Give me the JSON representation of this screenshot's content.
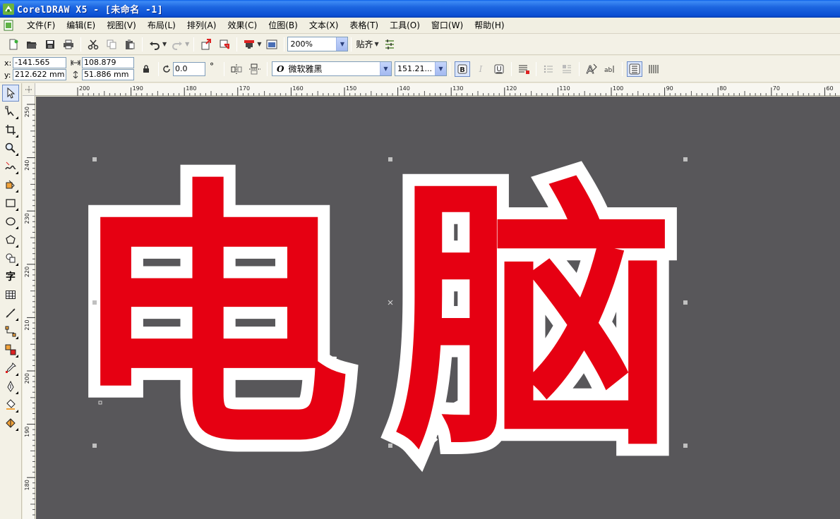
{
  "window": {
    "title": "CorelDRAW X5 - [未命名 -1]"
  },
  "menu": {
    "items": [
      {
        "label": "文件(F)"
      },
      {
        "label": "编辑(E)"
      },
      {
        "label": "视图(V)"
      },
      {
        "label": "布局(L)"
      },
      {
        "label": "排列(A)"
      },
      {
        "label": "效果(C)"
      },
      {
        "label": "位图(B)"
      },
      {
        "label": "文本(X)"
      },
      {
        "label": "表格(T)"
      },
      {
        "label": "工具(O)"
      },
      {
        "label": "窗口(W)"
      },
      {
        "label": "帮助(H)"
      }
    ]
  },
  "standard_toolbar": {
    "zoom_value": "200%",
    "snap_label": "贴齐"
  },
  "property_bar": {
    "x_label": "x:",
    "y_label": "y:",
    "x_value": "-141.565 mm",
    "y_value": "212.622 mm",
    "width_value": "108.879 mm",
    "height_value": "51.886 mm",
    "rotation_value": "0.0",
    "degree_symbol": "°",
    "font_name": "微软雅黑",
    "font_size": "151.21...",
    "font_style_glyph": "O"
  },
  "toolbox": {
    "text_tool_glyph": "字"
  },
  "ruler_h": {
    "ticks": [
      "200",
      "190",
      "180",
      "170",
      "160",
      "150",
      "140",
      "130",
      "120",
      "110",
      "100",
      "90",
      "80",
      "70",
      "60"
    ]
  },
  "ruler_v": {
    "ticks": [
      "250",
      "240",
      "230",
      "220",
      "210",
      "200",
      "190",
      "180"
    ]
  },
  "document": {
    "text": "电脑",
    "char_1": "电",
    "char_2": "脑",
    "fill_color": "#e60012",
    "outline_color": "#ffffff",
    "background_color": "#58575a"
  }
}
